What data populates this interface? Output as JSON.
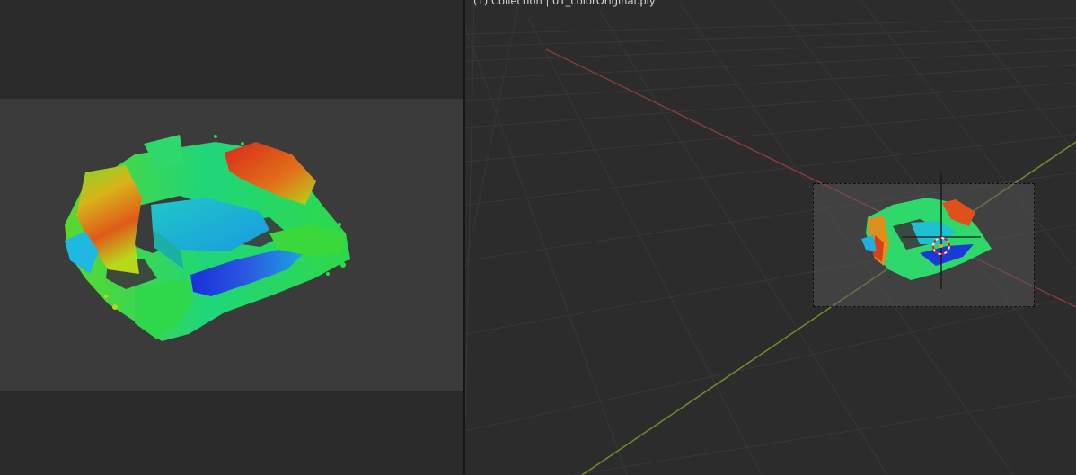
{
  "viewport": {
    "header_text": "(1) Collection | 01_colorOriginal.ply"
  },
  "render_view": {
    "backdrop": "#3b3b3b",
    "background": "#2a2a2a"
  },
  "colors": {
    "x_axis": "#9a3b3b",
    "y_axis": "#6e8a2a",
    "grid": "#3a3a3a",
    "colormap": [
      "#1a2fd8",
      "#19b8e0",
      "#1fd67a",
      "#3fd82a",
      "#b8d81a",
      "#e08a12",
      "#d8281a"
    ]
  }
}
